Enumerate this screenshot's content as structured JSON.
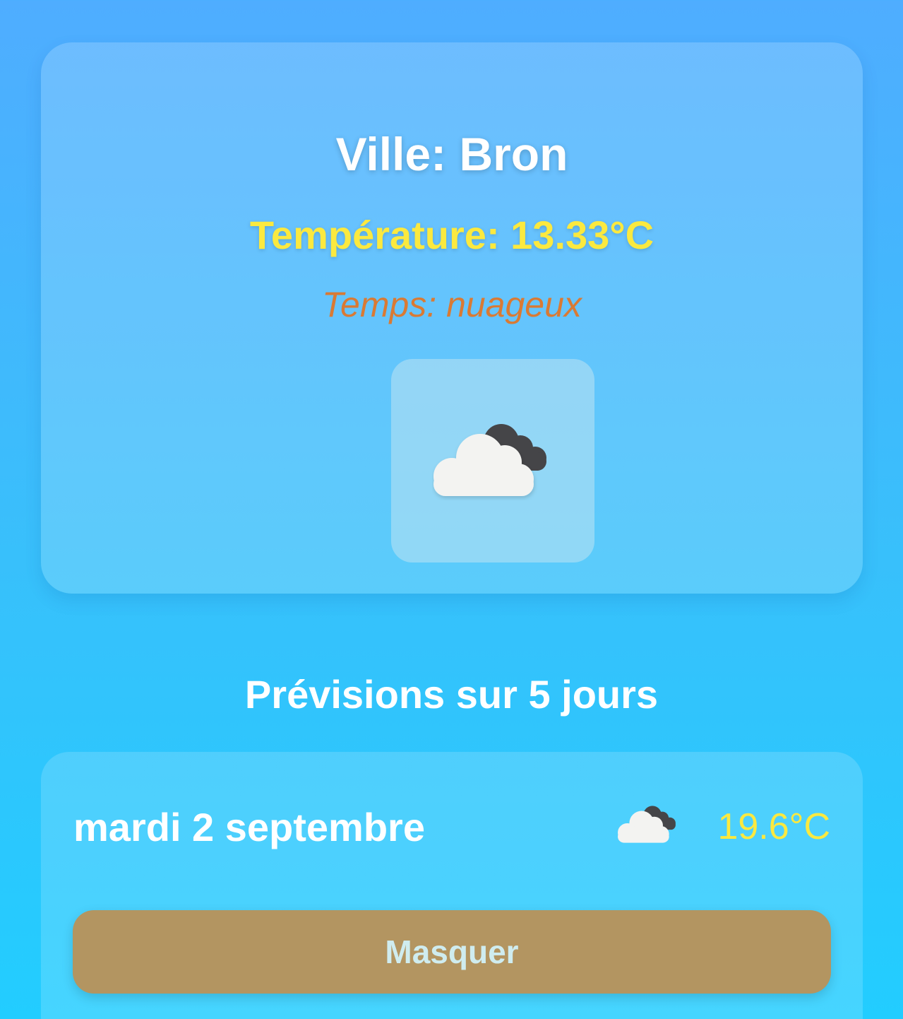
{
  "current": {
    "city": "Ville: Bron",
    "temperature": "Température: 13.33°C",
    "condition": "Temps: nuageux",
    "icon": "broken-clouds-icon"
  },
  "forecast": {
    "title": "Prévisions sur 5 jours",
    "days": [
      {
        "date": "mardi 2 septembre",
        "icon": "broken-clouds-icon",
        "temperature": "19.6°C"
      }
    ],
    "hide_label": "Masquer"
  },
  "colors": {
    "background_top": "#4fadff",
    "background_bottom": "#22cdff",
    "temperature_text": "#fbe93f",
    "condition_text": "#d97a34",
    "button_bg": "#b39561",
    "button_text": "#cfecef"
  }
}
